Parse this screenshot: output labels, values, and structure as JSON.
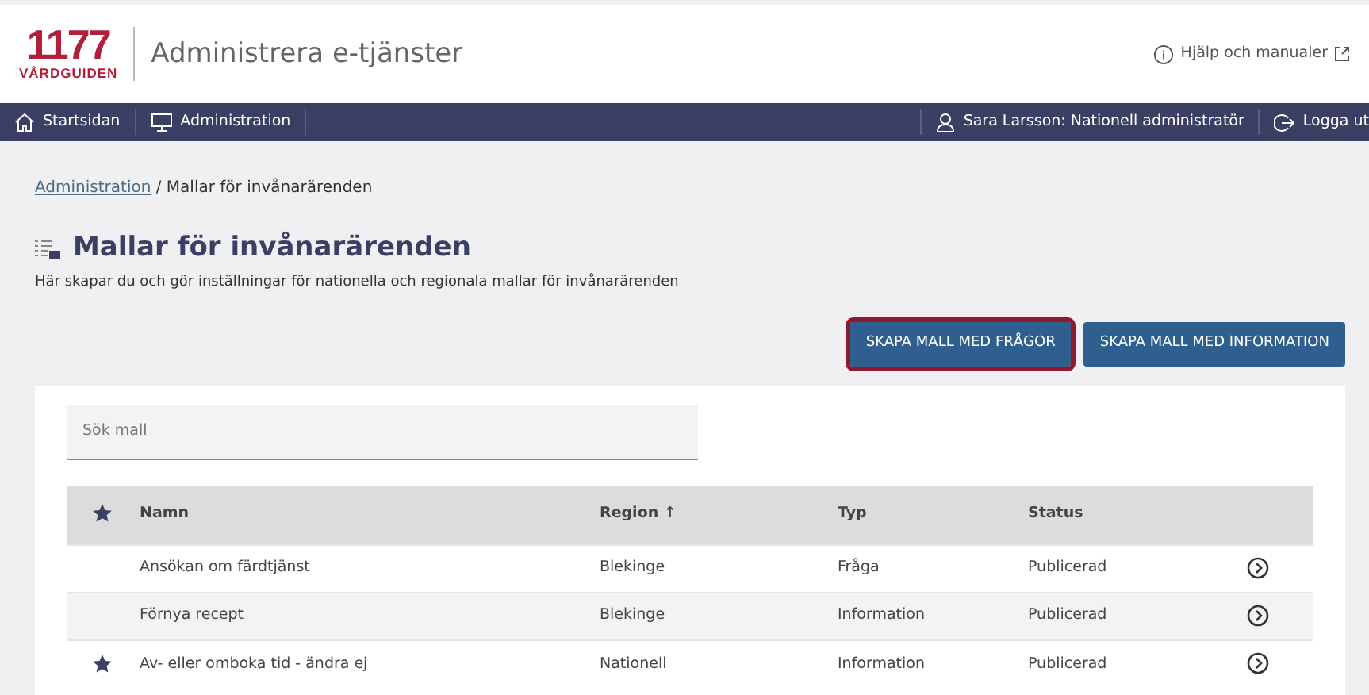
{
  "header": {
    "logo_number": "1177",
    "logo_text": "VÅRDGUIDEN",
    "app_title": "Administrera e-tjänster",
    "help_link": "Hjälp och manualer"
  },
  "navbar": {
    "left": [
      {
        "label": "Startsidan",
        "kind": "home"
      },
      {
        "label": "Administration",
        "kind": "monitor"
      }
    ],
    "user": "Sara Larsson: Nationell administratör",
    "logout": "Logga ut"
  },
  "breadcrumb": {
    "link": "Administration",
    "current": "/ Mallar för invånarärenden"
  },
  "page": {
    "title": "Mallar för invånarärenden",
    "subtitle": "Här skapar du och gör inställningar för nationella och regionala mallar för invånarärenden"
  },
  "buttons": [
    {
      "label": "SKAPA MALL MED FRÅGOR",
      "highlighted": true
    },
    {
      "label": "SKAPA MALL MED INFORMATION",
      "highlighted": false
    }
  ],
  "search": {
    "placeholder": "Sök mall"
  },
  "table": {
    "columns": [
      "Namn",
      "Region ↑",
      "Typ",
      "Status"
    ],
    "rows": [
      {
        "favorite": false,
        "name": "Ansökan om färdtjänst",
        "region": "Blekinge",
        "type": "Fråga",
        "status": "Publicerad"
      },
      {
        "favorite": false,
        "name": "Förnya recept",
        "region": "Blekinge",
        "type": "Information",
        "status": "Publicerad"
      },
      {
        "favorite": true,
        "name": "Av- eller omboka tid - ändra ej",
        "region": "Nationell",
        "type": "Information",
        "status": "Publicerad"
      }
    ]
  }
}
